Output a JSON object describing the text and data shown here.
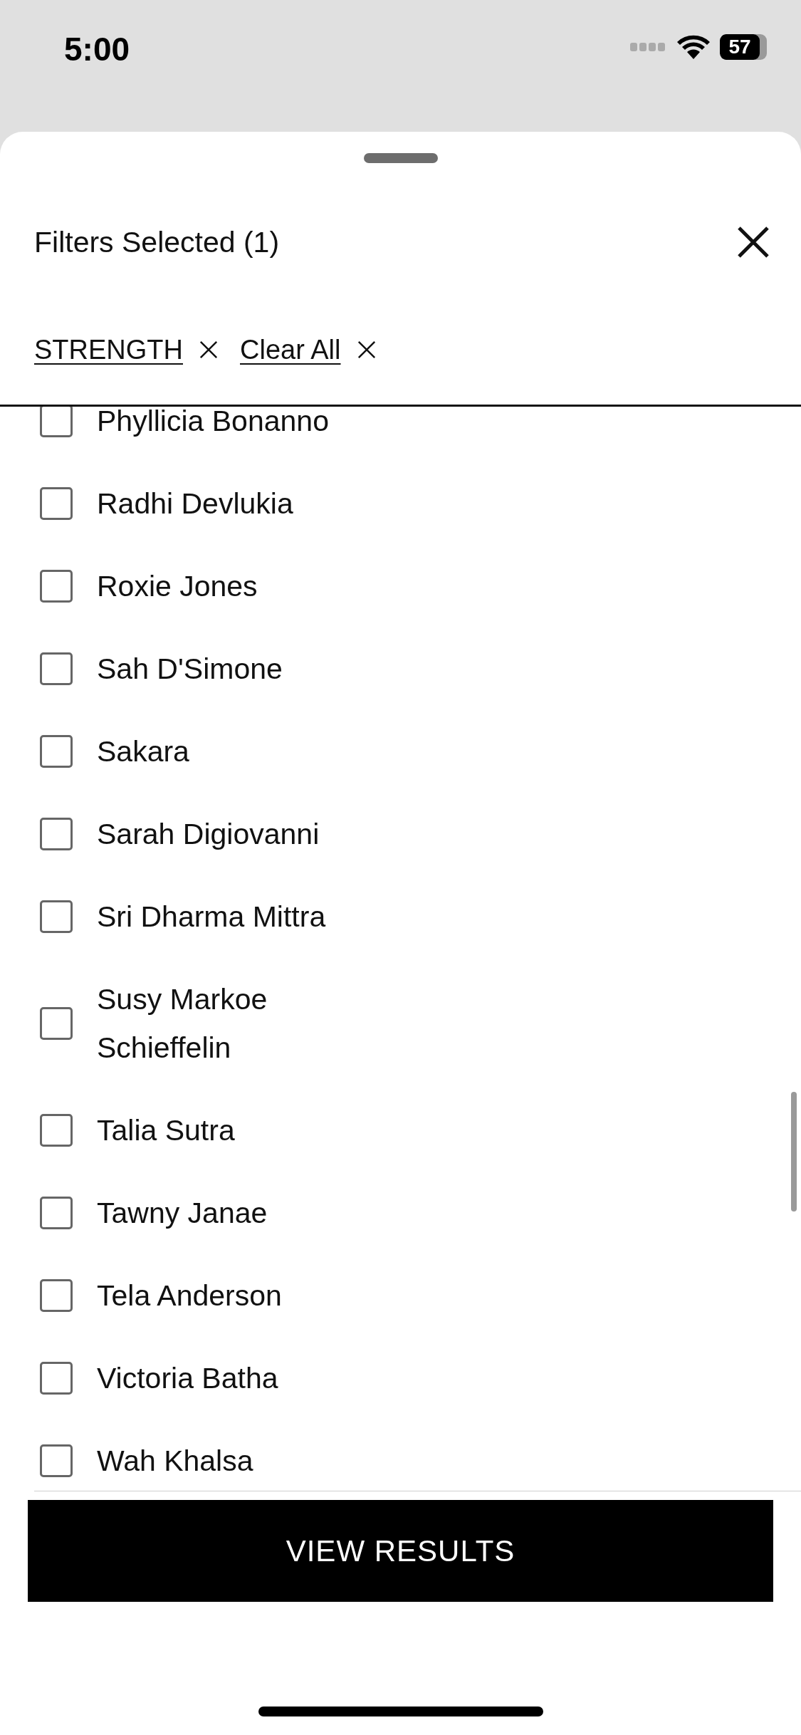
{
  "status_bar": {
    "time": "5:00",
    "battery": "57"
  },
  "sheet": {
    "title": "Filters Selected (1)",
    "chips": [
      {
        "label": "STRENGTH"
      },
      {
        "label": "Clear All"
      }
    ],
    "options": [
      {
        "label": "Phyllicia Bonanno",
        "checked": false
      },
      {
        "label": "Radhi Devlukia",
        "checked": false
      },
      {
        "label": "Roxie Jones",
        "checked": false
      },
      {
        "label": "Sah D'Simone",
        "checked": false
      },
      {
        "label": "Sakara",
        "checked": false
      },
      {
        "label": "Sarah Digiovanni",
        "checked": false
      },
      {
        "label": "Sri Dharma Mittra",
        "checked": false
      },
      {
        "label": "Susy Markoe Schieffelin",
        "checked": false
      },
      {
        "label": "Talia Sutra",
        "checked": false
      },
      {
        "label": "Tawny Janae",
        "checked": false
      },
      {
        "label": "Tela Anderson",
        "checked": false
      },
      {
        "label": "Victoria Batha",
        "checked": false
      },
      {
        "label": "Wah Khalsa",
        "checked": false
      }
    ],
    "button": "VIEW RESULTS"
  }
}
